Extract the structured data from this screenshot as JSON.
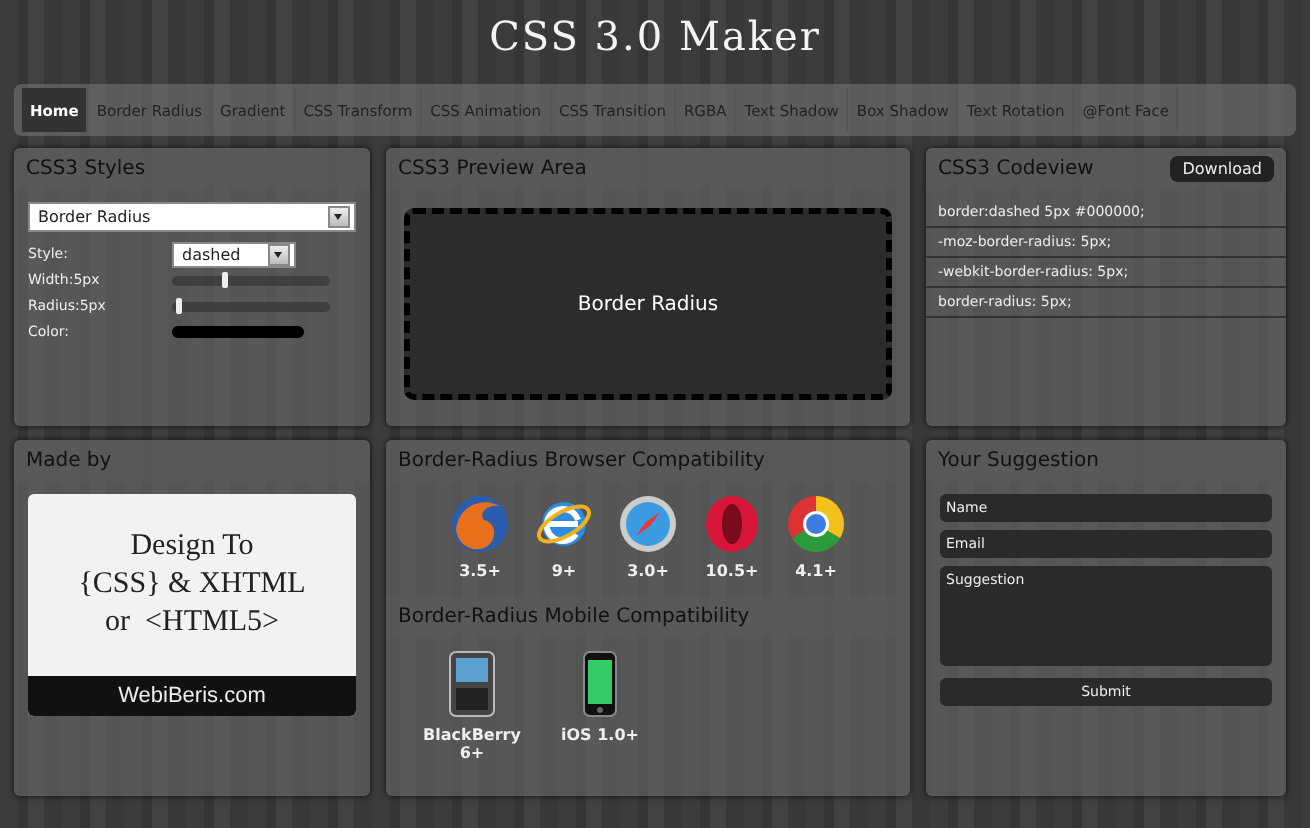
{
  "title": "CSS 3.0 Maker",
  "tabs": [
    {
      "label": "Home",
      "selected": true
    },
    {
      "label": "Border Radius",
      "selected": false
    },
    {
      "label": "Gradient",
      "selected": false
    },
    {
      "label": "CSS Transform",
      "selected": false
    },
    {
      "label": "CSS Animation",
      "selected": false
    },
    {
      "label": "CSS Transition",
      "selected": false
    },
    {
      "label": "RGBA",
      "selected": false
    },
    {
      "label": "Text Shadow",
      "selected": false
    },
    {
      "label": "Box Shadow",
      "selected": false
    },
    {
      "label": "Text Rotation",
      "selected": false
    },
    {
      "label": "@Font Face",
      "selected": false
    }
  ],
  "styles": {
    "heading": "CSS3 Styles",
    "select": "Border Radius",
    "style_label": "Style:",
    "style_value": "dashed",
    "sliders": [
      {
        "label": "Width:5px",
        "level": 0.32
      },
      {
        "label": "Radius:5px",
        "level": 0.03
      }
    ],
    "color_label": "Color:"
  },
  "preview": {
    "heading": "CSS3 Preview Area",
    "text": "Border Radius"
  },
  "codeview": {
    "heading": "CSS3 Codeview",
    "button": "Download",
    "lines": [
      "border:dashed 5px #000000;",
      "-moz-border-radius: 5px;",
      "-webkit-border-radius: 5px;",
      "border-radius: 5px;"
    ]
  },
  "made_by": {
    "heading": "Made by",
    "banner_lines": [
      "Design To",
      "{CSS} & XHTML",
      "or  <HTML5>"
    ],
    "site": "WebiBeris.com"
  },
  "browser_compat": {
    "heading": "Border-Radius Browser Compatibility",
    "items": [
      {
        "kind": "fox",
        "version": "3.5+"
      },
      {
        "kind": "e",
        "version": "9+"
      },
      {
        "kind": "compass",
        "version": "3.0+"
      },
      {
        "kind": "o",
        "version": "10.5+"
      },
      {
        "kind": "wheel",
        "version": "4.1+"
      }
    ]
  },
  "mobile_compat": {
    "heading": "Border-Radius Mobile Compatibility",
    "items": [
      {
        "kind": "keyboard-phone",
        "version": "BlackBerry 6+"
      },
      {
        "kind": "touch-phone",
        "version": "iOS 1.0+"
      }
    ]
  },
  "suggestion": {
    "heading": "Your Suggestion",
    "fields": [
      {
        "kind": "line",
        "placeholder": "Name"
      },
      {
        "kind": "line",
        "placeholder": "Email"
      },
      {
        "kind": "area",
        "placeholder": "Suggestion"
      }
    ],
    "button": "Submit"
  }
}
